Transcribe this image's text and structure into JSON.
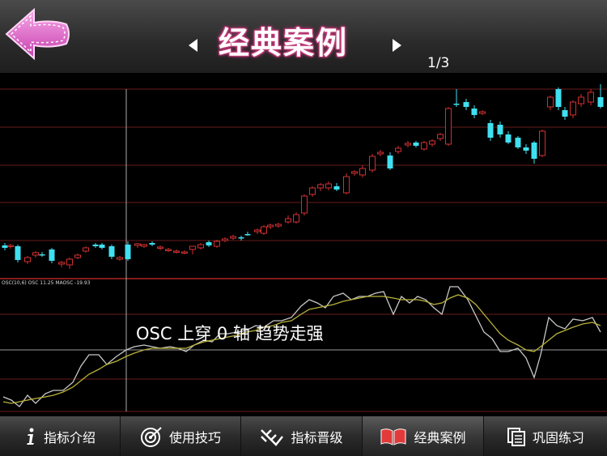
{
  "header": {
    "title": "经典案例",
    "page_indicator": "1/3"
  },
  "chart": {
    "indicator_legend": "OSC(10,6) OSC 11.25  MAOSC -19.93",
    "annotation": "OSC 上穿 0 轴 趋势走强",
    "colors": {
      "up": "#d23030",
      "down": "#3fe0f0",
      "osc": "#c8c8c8",
      "maosc": "#b8b23a",
      "grid": "#6a1b1b",
      "zero_line": "#9a9a9a"
    }
  },
  "tabs": [
    {
      "label": "指标介绍",
      "icon": "info-icon"
    },
    {
      "label": "使用技巧",
      "icon": "target-icon"
    },
    {
      "label": "指标晋级",
      "icon": "upgrade-icon"
    },
    {
      "label": "经典案例",
      "icon": "book-icon"
    },
    {
      "label": "巩固练习",
      "icon": "document-icon"
    }
  ]
}
